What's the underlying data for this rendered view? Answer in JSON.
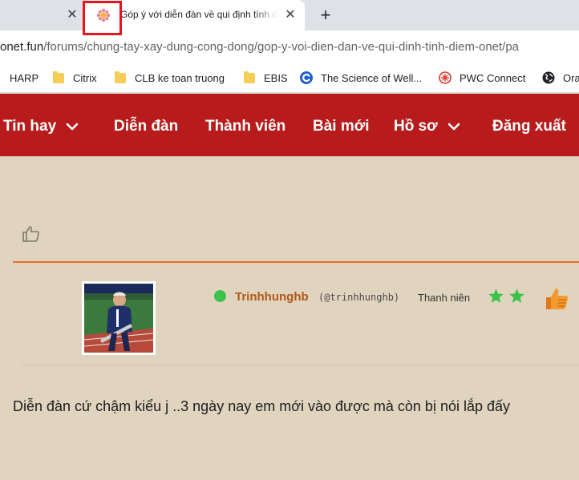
{
  "browser": {
    "tab_title": "Góp ý với diễn đàn về qui định tính điểm onet",
    "url_host": "onet.fun",
    "url_path": "/forums/chung-tay-xay-dung-cong-dong/gop-y-voi-dien-dan-ve-qui-dinh-tinh-diem-onet/pa",
    "bookmarks": [
      "HARP",
      "Citrix",
      "CLB ke toan truong",
      "EBIS",
      "The Science of Well...",
      "PWC Connect",
      "Ora"
    ]
  },
  "nav": {
    "items": [
      "Tin hay",
      "Diễn đàn",
      "Thành viên",
      "Bài mới",
      "Hồ sơ",
      "Đăng xuất"
    ]
  },
  "post": {
    "username": "Trinhhunghb",
    "handle": "(@trinhhunghb)",
    "rank": "Thanh niên",
    "stars": 2,
    "text": "Diễn đàn cứ chậm kiểu j ..3 ngày nay em mới vào được mà còn bị nói lắp đấy"
  },
  "colors": {
    "nav_bg": "#b81b1b",
    "page_bg": "#e0d4bf",
    "username": "#b2561a",
    "accent_line": "#e8702a",
    "online": "#3cc24a",
    "star": "#3cc24a"
  }
}
